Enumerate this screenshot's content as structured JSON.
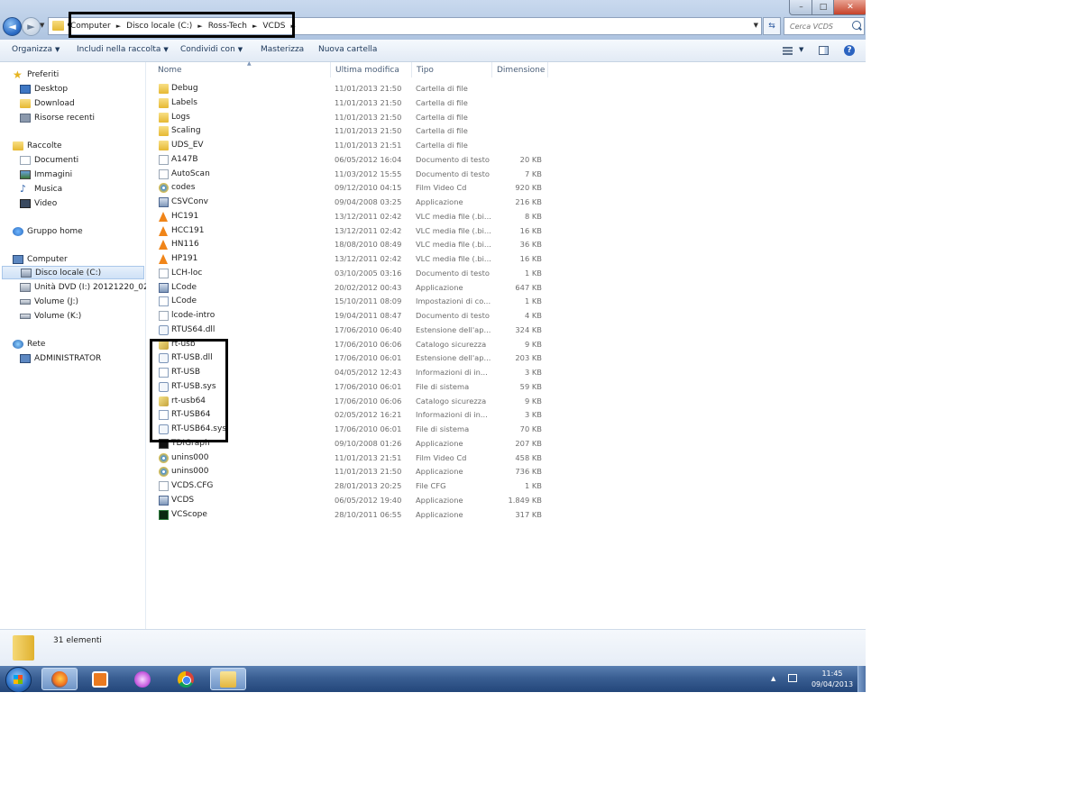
{
  "window": {
    "controls": {
      "minimize": "–",
      "maximize": "□",
      "close": "✕"
    }
  },
  "address": {
    "breadcrumbs": [
      "Computer",
      "Disco locale (C:)",
      "Ross-Tech",
      "VCDS"
    ]
  },
  "search": {
    "placeholder": "Cerca VCDS"
  },
  "toolbar": {
    "organize": "Organizza",
    "include": "Includi nella raccolta",
    "share": "Condividi con",
    "burn": "Masterizza",
    "new_folder": "Nuova cartella",
    "help": "?"
  },
  "nav": {
    "favorites": "Preferiti",
    "desktop": "Desktop",
    "download": "Download",
    "recent": "Risorse recenti",
    "libraries": "Raccolte",
    "documents": "Documenti",
    "images": "Immagini",
    "music": "Musica",
    "video": "Video",
    "homegroup": "Gruppo home",
    "computer": "Computer",
    "disk_c": "Disco locale (C:)",
    "dvd": "Unità DVD (I:) 20121220_0205",
    "vol_j": "Volume (J:)",
    "vol_k": "Volume (K:)",
    "network": "Rete",
    "admin": "ADMINISTRATOR"
  },
  "columns": {
    "name": "Nome",
    "modified": "Ultima modifica",
    "type": "Tipo",
    "size": "Dimensione"
  },
  "files": [
    {
      "name": "Debug",
      "date": "11/01/2013 21:50",
      "type": "Cartella di file",
      "size": "",
      "icon": "folder-icon"
    },
    {
      "name": "Labels",
      "date": "11/01/2013 21:50",
      "type": "Cartella di file",
      "size": "",
      "icon": "folder-icon"
    },
    {
      "name": "Logs",
      "date": "11/01/2013 21:50",
      "type": "Cartella di file",
      "size": "",
      "icon": "folder-icon"
    },
    {
      "name": "Scaling",
      "date": "11/01/2013 21:50",
      "type": "Cartella di file",
      "size": "",
      "icon": "folder-icon"
    },
    {
      "name": "UDS_EV",
      "date": "11/01/2013 21:51",
      "type": "Cartella di file",
      "size": "",
      "icon": "folder-icon"
    },
    {
      "name": "A147B",
      "date": "06/05/2012 16:04",
      "type": "Documento di testo",
      "size": "20 KB",
      "icon": "text-file-icon"
    },
    {
      "name": "AutoScan",
      "date": "11/03/2012 15:55",
      "type": "Documento di testo",
      "size": "7 KB",
      "icon": "text-file-icon"
    },
    {
      "name": "codes",
      "date": "09/12/2010 04:15",
      "type": "Film Video Cd",
      "size": "920 KB",
      "icon": "disc-icon"
    },
    {
      "name": "CSVConv",
      "date": "09/04/2008 03:25",
      "type": "Applicazione",
      "size": "216 KB",
      "icon": "app-icon"
    },
    {
      "name": "HC191",
      "date": "13/12/2011 02:42",
      "type": "VLC media file (.bi...",
      "size": "8 KB",
      "icon": "vlc-icon"
    },
    {
      "name": "HCC191",
      "date": "13/12/2011 02:42",
      "type": "VLC media file (.bi...",
      "size": "16 KB",
      "icon": "vlc-icon"
    },
    {
      "name": "HN116",
      "date": "18/08/2010 08:49",
      "type": "VLC media file (.bi...",
      "size": "36 KB",
      "icon": "vlc-icon"
    },
    {
      "name": "HP191",
      "date": "13/12/2011 02:42",
      "type": "VLC media file (.bi...",
      "size": "16 KB",
      "icon": "vlc-icon"
    },
    {
      "name": "LCH-loc",
      "date": "03/10/2005 03:16",
      "type": "Documento di testo",
      "size": "1 KB",
      "icon": "text-file-icon"
    },
    {
      "name": "LCode",
      "date": "20/02/2012 00:43",
      "type": "Applicazione",
      "size": "647 KB",
      "icon": "app-icon"
    },
    {
      "name": "LCode",
      "date": "15/10/2011 08:09",
      "type": "Impostazioni di co...",
      "size": "1 KB",
      "icon": "settings-file-icon"
    },
    {
      "name": "lcode-intro",
      "date": "19/04/2011 08:47",
      "type": "Documento di testo",
      "size": "4 KB",
      "icon": "text-file-icon"
    },
    {
      "name": "RTUS64.dll",
      "date": "17/06/2010 06:40",
      "type": "Estensione dell'ap...",
      "size": "324 KB",
      "icon": "dll-icon"
    },
    {
      "name": "rt-usb",
      "date": "17/06/2010 06:06",
      "type": "Catalogo sicurezza",
      "size": "9 KB",
      "icon": "security-catalog-icon"
    },
    {
      "name": "RT-USB.dll",
      "date": "17/06/2010 06:01",
      "type": "Estensione dell'ap...",
      "size": "203 KB",
      "icon": "dll-icon"
    },
    {
      "name": "RT-USB",
      "date": "04/05/2012 12:43",
      "type": "Informazioni di in...",
      "size": "3 KB",
      "icon": "setup-info-icon"
    },
    {
      "name": "RT-USB.sys",
      "date": "17/06/2010 06:01",
      "type": "File di sistema",
      "size": "59 KB",
      "icon": "system-file-icon"
    },
    {
      "name": "rt-usb64",
      "date": "17/06/2010 06:06",
      "type": "Catalogo sicurezza",
      "size": "9 KB",
      "icon": "security-catalog-icon"
    },
    {
      "name": "RT-USB64",
      "date": "02/05/2012 16:21",
      "type": "Informazioni di in...",
      "size": "3 KB",
      "icon": "setup-info-icon"
    },
    {
      "name": "RT-USB64.sys",
      "date": "17/06/2010 06:01",
      "type": "File di sistema",
      "size": "70 KB",
      "icon": "system-file-icon"
    },
    {
      "name": "TDIGraph",
      "date": "09/10/2008 01:26",
      "type": "Applicazione",
      "size": "207 KB",
      "icon": "graph-app-icon"
    },
    {
      "name": "unins000",
      "date": "11/01/2013 21:51",
      "type": "Film Video Cd",
      "size": "458 KB",
      "icon": "disc-icon"
    },
    {
      "name": "unins000",
      "date": "11/01/2013 21:50",
      "type": "Applicazione",
      "size": "736 KB",
      "icon": "uninstaller-icon"
    },
    {
      "name": "VCDS.CFG",
      "date": "28/01/2013 20:25",
      "type": "File CFG",
      "size": "1 KB",
      "icon": "text-file-icon"
    },
    {
      "name": "VCDS",
      "date": "06/05/2012 19:40",
      "type": "Applicazione",
      "size": "1.849 KB",
      "icon": "app-icon"
    },
    {
      "name": "VCScope",
      "date": "28/10/2011 06:55",
      "type": "Applicazione",
      "size": "317 KB",
      "icon": "scope-app-icon"
    }
  ],
  "details": {
    "count": "31 elementi"
  },
  "taskbar": {
    "apps": [
      "firefox-icon",
      "media-player-icon",
      "messenger-icon",
      "chrome-icon",
      "explorer-icon"
    ],
    "time": "11:45",
    "date": "09/04/2013"
  }
}
